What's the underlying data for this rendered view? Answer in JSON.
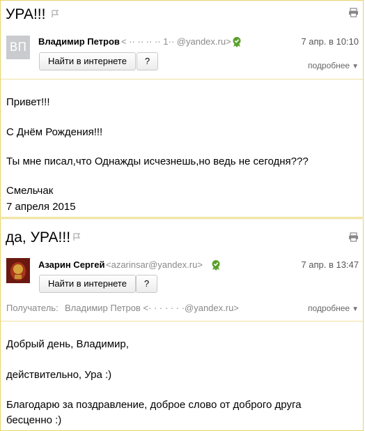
{
  "messages": [
    {
      "subject": "УРА!!!",
      "sender_name": "Владимир Петров",
      "sender_email": "< ·· ·· ·· ·· 1·· @yandex.ru>",
      "date": "7 апр. в 10:10",
      "avatar_initials": "ВП",
      "search_button": "Найти в интернете",
      "question_button": "?",
      "more_link": "подробнее",
      "body": [
        "Привет!!!",
        "С Днём Рождения!!!",
        "Ты мне писал,что Однажды исчезнешь,но ведь не сегодня???",
        "Смельчак",
        "7 апреля 2015"
      ]
    },
    {
      "subject": "да, УРА!!!",
      "sender_name": "Азарин Сергей",
      "sender_email": "<azarinsar@yandex.ru>",
      "date": "7 апр. в 13:47",
      "search_button": "Найти в интернете",
      "question_button": "?",
      "recipient_label": "Получатель:",
      "recipient": "Владимир Петров <· · · · · · ·@yandex.ru>",
      "more_link": "подробнее",
      "body": [
        "Добрый день, Владимир,",
        "действительно, Ура :)",
        "Благодарю за поздравление, доброе слово от доброго друга",
        "бесценно :)"
      ]
    }
  ],
  "colors": {
    "border": "#e9d36a",
    "verified": "#5aa02c",
    "avatar1_bg": "#c9cbcf",
    "avatar2_bg": "#7a1c12"
  },
  "icons": {
    "flag": "flag-icon",
    "print": "print-icon",
    "verified": "verified-badge-icon",
    "more": "chevron-down-icon"
  }
}
